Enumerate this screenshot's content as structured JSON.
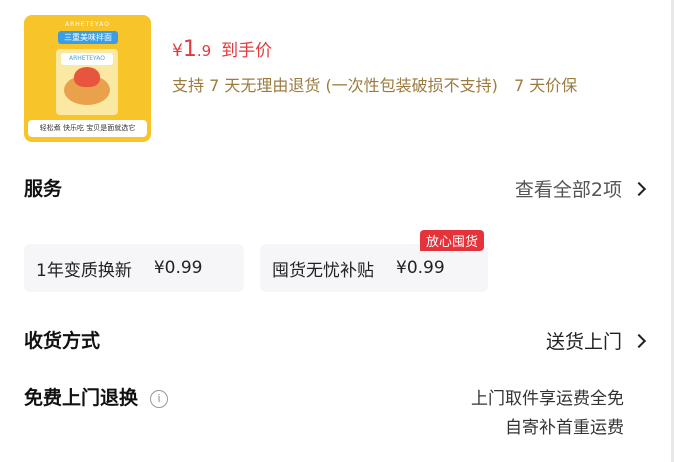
{
  "product": {
    "thumb_brand": "ARHETEYAO",
    "thumb_tag": "三重美味拌面",
    "thumb_label": "ARHETEYAO",
    "thumb_bottom": "轻松煮 快乐吃 宝贝是面就选它"
  },
  "price": {
    "symbol": "¥",
    "integer": "1",
    "decimal": ".9",
    "label": "到手价"
  },
  "guarantee": {
    "line1": "支持 7 天无理由退货 (一次性包装破损不支持)",
    "line2": "7 天价保"
  },
  "service": {
    "title": "服务",
    "view_all": "查看全部2项",
    "cards": [
      {
        "name": "1年变质换新",
        "price": "¥0.99"
      },
      {
        "name": "囤货无忧补贴",
        "price": "¥0.99",
        "badge": "放心囤货"
      }
    ]
  },
  "delivery": {
    "title": "收货方式",
    "value": "送货上门"
  },
  "free_return": {
    "title": "免费上门退换",
    "info_icon": "i",
    "line1": "上门取件享运费全免",
    "line2": "自寄补首重运费"
  },
  "colors": {
    "price_red": "#e4393c",
    "guarantee_gold": "#9c7b3f",
    "badge_red": "#e5333b"
  }
}
